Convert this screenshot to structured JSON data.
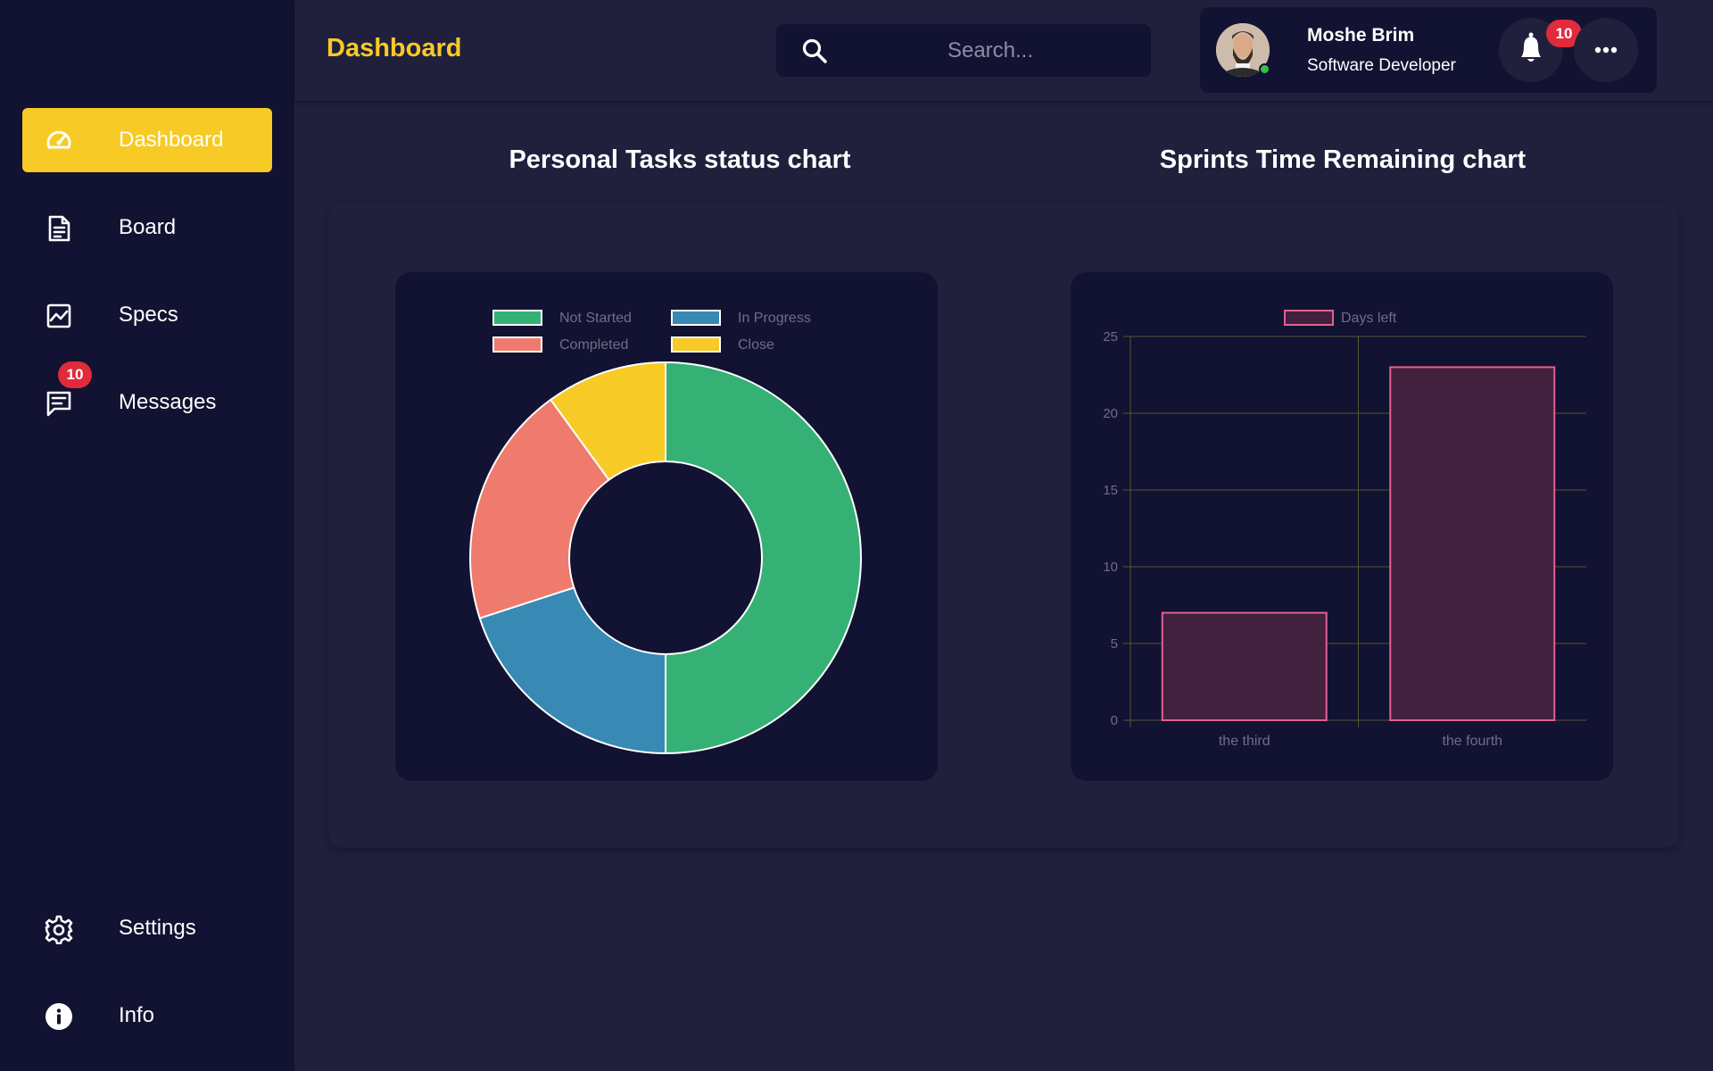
{
  "sidebar": {
    "items": [
      {
        "label": "Dashboard",
        "icon": "speedometer-icon",
        "active": true
      },
      {
        "label": "Board",
        "icon": "document-icon"
      },
      {
        "label": "Specs",
        "icon": "chart-image-icon"
      },
      {
        "label": "Messages",
        "icon": "chat-icon",
        "badge": "10"
      }
    ],
    "bottom_items": [
      {
        "label": "Settings",
        "icon": "gear-icon"
      },
      {
        "label": "Info",
        "icon": "info-icon"
      }
    ]
  },
  "header": {
    "title": "Dashboard",
    "search": {
      "placeholder": "Search...",
      "value": ""
    },
    "user": {
      "name": "Moshe Brim",
      "role": "Software Developer",
      "status": "online"
    },
    "notifications_badge": "10"
  },
  "main": {
    "pie_title": "Personal Tasks status chart",
    "bar_title": "Sprints Time Remaining chart"
  },
  "colors": {
    "accent": "#f7ca26",
    "sidebar_bg": "#121232",
    "page_bg": "#20203d",
    "badge": "#e02b3c"
  },
  "chart_data": [
    {
      "type": "pie",
      "variant": "doughnut",
      "title": "Personal Tasks status chart",
      "legend_position": "top",
      "labels": [
        "Not Started",
        "In Progress",
        "Completed",
        "Close"
      ],
      "values": [
        50,
        20,
        20,
        10
      ],
      "colors": [
        "#36b176",
        "#3889b4",
        "#ef7b6e",
        "#f7ca26"
      ]
    },
    {
      "type": "bar",
      "title": "Sprints Time Remaining chart",
      "categories": [
        "the third",
        "the fourth"
      ],
      "series": [
        {
          "name": "Days left",
          "values": [
            7,
            23
          ]
        }
      ],
      "ylim": [
        0,
        25
      ],
      "yticks": [
        0,
        5,
        10,
        15,
        20,
        25
      ],
      "grid": true,
      "legend_position": "top",
      "colors": {
        "fill": "#42213f",
        "stroke": "#e06192"
      }
    }
  ]
}
